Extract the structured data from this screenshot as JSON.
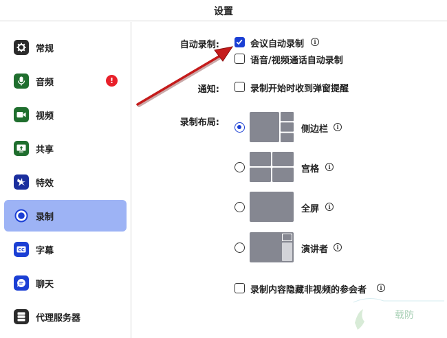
{
  "window": {
    "title": "设置"
  },
  "sidebar": {
    "items": [
      {
        "label": "常规",
        "icon": "gear-icon",
        "color": "#222222"
      },
      {
        "label": "音频",
        "icon": "microphone-icon",
        "color": "#1f6e2e",
        "badge": "!"
      },
      {
        "label": "视频",
        "icon": "video-camera-icon",
        "color": "#1f6e2e"
      },
      {
        "label": "共享",
        "icon": "share-screen-icon",
        "color": "#1f6e2e"
      },
      {
        "label": "特效",
        "icon": "effects-icon",
        "color": "#1b2f9e"
      },
      {
        "label": "录制",
        "icon": "record-icon",
        "color": "#1b3fd4",
        "active": true
      },
      {
        "label": "字幕",
        "icon": "captions-icon",
        "color": "#1b3fd4"
      },
      {
        "label": "聊天",
        "icon": "chat-icon",
        "color": "#1b3fd4"
      },
      {
        "label": "代理服务器",
        "icon": "server-icon",
        "color": "#222222"
      }
    ]
  },
  "recording": {
    "auto_record_label": "自动录制:",
    "auto_record_meeting": {
      "label": "会议自动录制",
      "checked": true
    },
    "auto_record_voice": {
      "label": "语音/视频通话自动录制",
      "checked": false
    },
    "notify_label": "通知:",
    "notify_popup": {
      "label": "录制开始时收到弹窗提醒",
      "checked": false
    },
    "layout_label": "录制布局:",
    "layouts": [
      {
        "label": "侧边栏",
        "selected": true
      },
      {
        "label": "宫格",
        "selected": false
      },
      {
        "label": "全屏",
        "selected": false
      },
      {
        "label": "演讲者",
        "selected": false
      }
    ],
    "hide_nonvideo": {
      "label": "录制内容隐藏非视频的参会者",
      "checked": false
    }
  },
  "colors": {
    "accent": "#1b3fd4",
    "active_bg": "#9db3f5",
    "thumb": "#858791",
    "badge": "#e8202a",
    "arrow": "#c51b1b"
  },
  "watermark": {
    "text": "载防"
  }
}
